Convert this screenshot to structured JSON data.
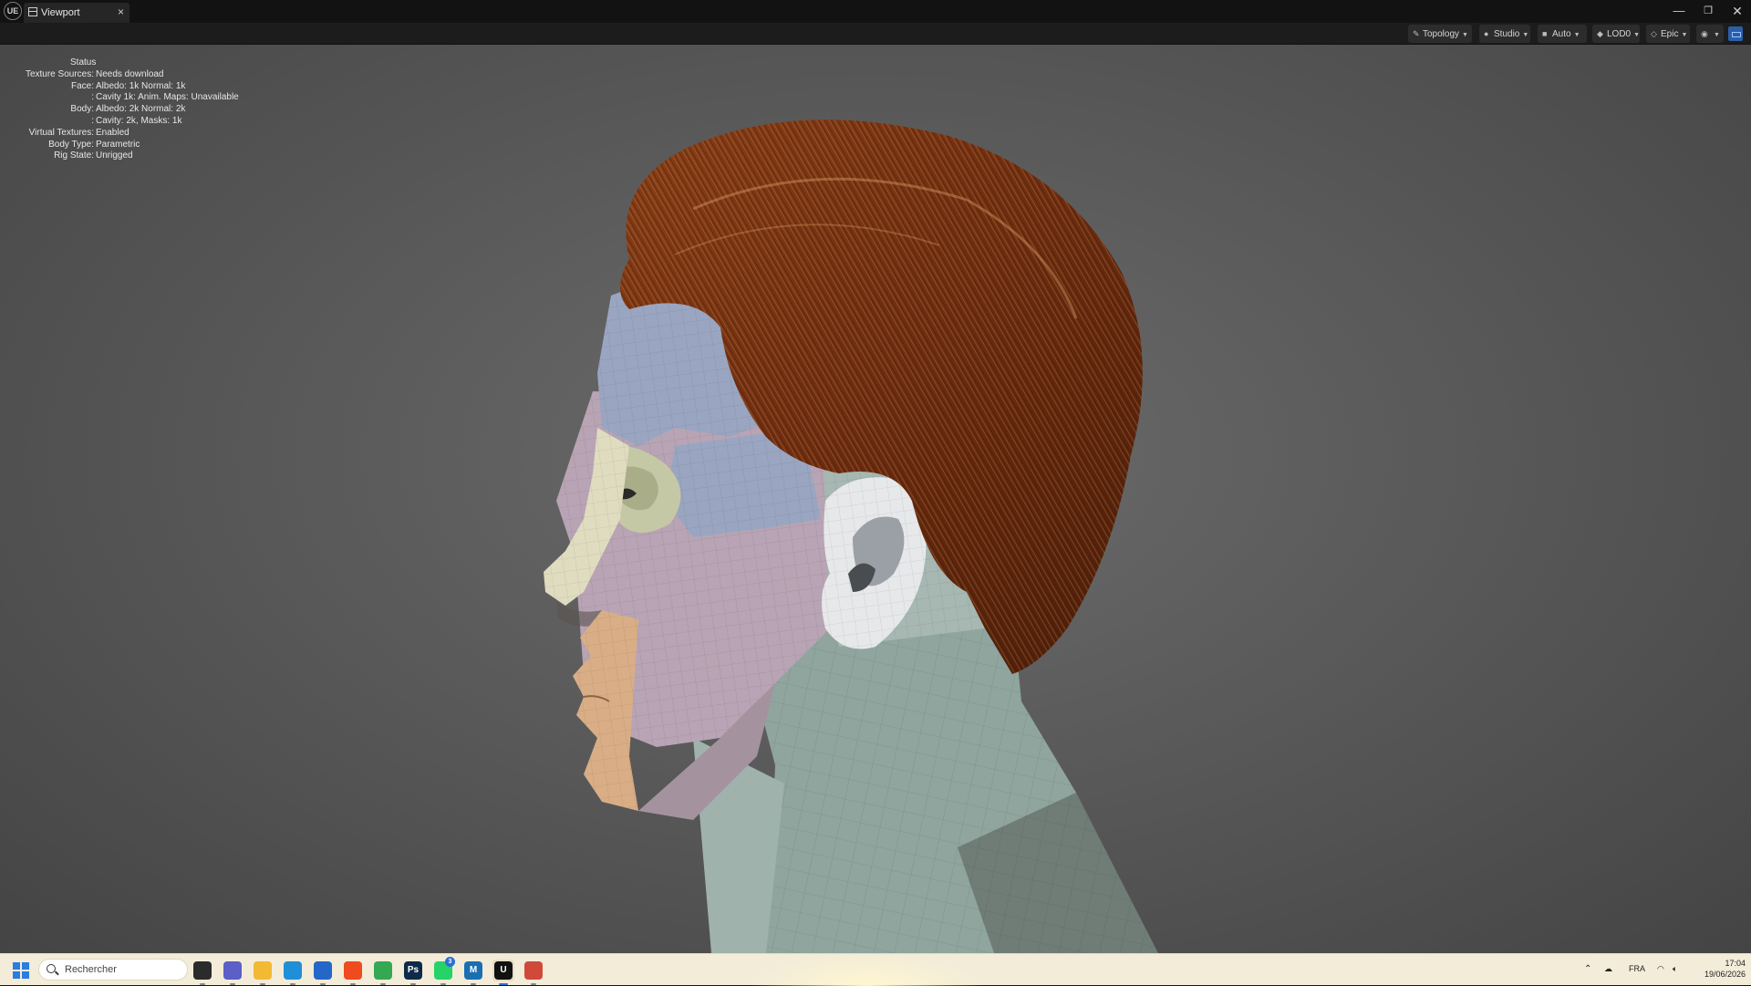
{
  "titlebar": {
    "logo_text": "UE",
    "tab_label": "Viewport",
    "tab_close": "×",
    "minimize": "—",
    "maximize": "❐",
    "close": "✕"
  },
  "toolbar": {
    "topology": "Topology",
    "studio": "Studio",
    "auto": "Auto",
    "lod": "LOD0",
    "epic": "Epic"
  },
  "status": {
    "title": "Status",
    "rows": [
      {
        "key": "Texture Sources:",
        "value": "Needs download"
      },
      {
        "key": "Face:",
        "value": "Albedo: 1k Normal: 1k"
      },
      {
        "key": ":",
        "value": "Cavity 1k: Anim. Maps: Unavailable"
      },
      {
        "key": "Body:",
        "value": "Albedo: 2k Normal: 2k"
      },
      {
        "key": ":",
        "value": "Cavity: 2k, Masks: 1k"
      },
      {
        "key": "Virtual Textures:",
        "value": "Enabled"
      },
      {
        "key": "Body Type:",
        "value": "Parametric"
      },
      {
        "key": "Rig State:",
        "value": "Unrigged"
      }
    ]
  },
  "taskbar": {
    "search_placeholder": "Rechercher",
    "apps": [
      {
        "name": "task-view",
        "label": "",
        "color": "#2b2b2b"
      },
      {
        "name": "teams",
        "label": "",
        "color": "#5b5fc7"
      },
      {
        "name": "file-explorer",
        "label": "",
        "color": "#f2b933"
      },
      {
        "name": "edge",
        "label": "",
        "color": "#1f8fd8"
      },
      {
        "name": "microsoft-store",
        "label": "",
        "color": "#2467c8"
      },
      {
        "name": "brave",
        "label": "",
        "color": "#f04a1f"
      },
      {
        "name": "chrome",
        "label": "",
        "color": "#34a853"
      },
      {
        "name": "photoshop",
        "label": "Ps",
        "color": "#0e2a4a"
      },
      {
        "name": "whatsapp",
        "label": "",
        "color": "#25d366"
      },
      {
        "name": "metahuman",
        "label": "M",
        "color": "#1a6fb3"
      },
      {
        "name": "unreal-engine",
        "label": "U",
        "color": "#111111"
      },
      {
        "name": "snipping-tool",
        "label": "",
        "color": "#d04a3a"
      }
    ],
    "whatsapp_badge": "3",
    "language": "FRA",
    "time": "17:04",
    "date": "19/06/2026"
  }
}
